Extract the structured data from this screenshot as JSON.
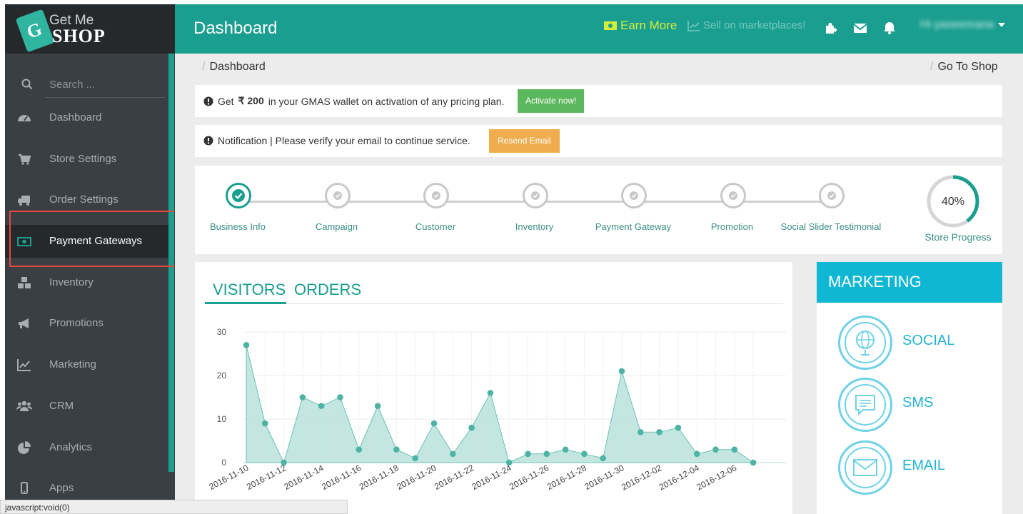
{
  "app": {
    "logo_line1": "Get Me",
    "logo_line2": "SHOP"
  },
  "header": {
    "title": "Dashboard",
    "earn_more": "Earn More",
    "sell_marketplaces": "Sell on marketplaces!",
    "user_greeting": "Hi yaseenrana"
  },
  "sidebar": {
    "search_placeholder": "Search ...",
    "items": [
      {
        "label": "Dashboard",
        "icon": "dashboard-icon"
      },
      {
        "label": "Store Settings",
        "icon": "cart-icon"
      },
      {
        "label": "Order Settings",
        "icon": "truck-icon"
      },
      {
        "label": "Payment Gateways",
        "icon": "money-icon",
        "active": true
      },
      {
        "label": "Inventory",
        "icon": "cubes-icon"
      },
      {
        "label": "Promotions",
        "icon": "megaphone-icon"
      },
      {
        "label": "Marketing",
        "icon": "line-chart-icon"
      },
      {
        "label": "CRM",
        "icon": "users-icon"
      },
      {
        "label": "Analytics",
        "icon": "pie-chart-icon"
      },
      {
        "label": "Apps",
        "icon": "mobile-icon"
      }
    ]
  },
  "breadcrumb": {
    "current": "Dashboard",
    "go_to_shop": "Go To Shop"
  },
  "promo": {
    "text_before": "Get",
    "amount": "₹ 200",
    "text_after": "in your GMAS wallet on activation of any pricing plan.",
    "button": "Activate now!"
  },
  "notification": {
    "text": "Notification |  Please verify your email to continue service.",
    "button": "Resend Email"
  },
  "steps": [
    {
      "label": "Business Info",
      "done": true
    },
    {
      "label": "Campaign",
      "done": false
    },
    {
      "label": "Customer",
      "done": false
    },
    {
      "label": "Inventory",
      "done": false
    },
    {
      "label": "Payment Gateway",
      "done": false
    },
    {
      "label": "Promotion",
      "done": false
    },
    {
      "label": "Social Slider Testimonial",
      "done": false
    }
  ],
  "store_progress": {
    "percent_text": "40%",
    "value": 0.4,
    "label": "Store Progress"
  },
  "chart_tabs": {
    "visitors": "VISITORS",
    "orders": "ORDERS"
  },
  "marketing": {
    "title": "MARKETING",
    "items": [
      {
        "label": "SOCIAL",
        "icon": "globe-icon"
      },
      {
        "label": "SMS",
        "icon": "sms-icon"
      },
      {
        "label": "EMAIL",
        "icon": "email-icon"
      }
    ]
  },
  "statusbar": {
    "text": "javascript:void(0)"
  },
  "colors": {
    "teal": "#1a9e8f",
    "sidebar": "#3a3f44",
    "cyan": "#10b7d4",
    "green_button": "#5cb85c",
    "orange_button": "#f0ad4e",
    "highlight": "#e3483c"
  },
  "chart_data": {
    "type": "area",
    "title": "",
    "xlabel": "",
    "ylabel": "",
    "ylim": [
      0,
      30
    ],
    "yticks": [
      0,
      10,
      20,
      30
    ],
    "grid": true,
    "x": [
      "2016-11-10",
      "2016-11-11",
      "2016-11-12",
      "2016-11-13",
      "2016-11-14",
      "2016-11-15",
      "2016-11-16",
      "2016-11-17",
      "2016-11-18",
      "2016-11-19",
      "2016-11-20",
      "2016-11-21",
      "2016-11-22",
      "2016-11-23",
      "2016-11-24",
      "2016-11-25",
      "2016-11-26",
      "2016-11-27",
      "2016-11-28",
      "2016-11-29",
      "2016-11-30",
      "2016-12-01",
      "2016-12-02",
      "2016-12-03",
      "2016-12-04",
      "2016-12-05",
      "2016-12-06",
      "2016-12-07"
    ],
    "xticks": [
      "2016-11-10",
      "2016-11-12",
      "2016-11-14",
      "2016-11-16",
      "2016-11-18",
      "2016-11-20",
      "2016-11-22",
      "2016-11-24",
      "2016-11-26",
      "2016-11-28",
      "2016-11-30",
      "2016-12-02",
      "2016-12-04",
      "2016-12-06"
    ],
    "series": [
      {
        "values": [
          27,
          9,
          0,
          15,
          13,
          15,
          3,
          13,
          3,
          1,
          9,
          2,
          8,
          16,
          0,
          2,
          2,
          3,
          2,
          1,
          21,
          7,
          7,
          8,
          2,
          3,
          3,
          0
        ]
      }
    ]
  }
}
